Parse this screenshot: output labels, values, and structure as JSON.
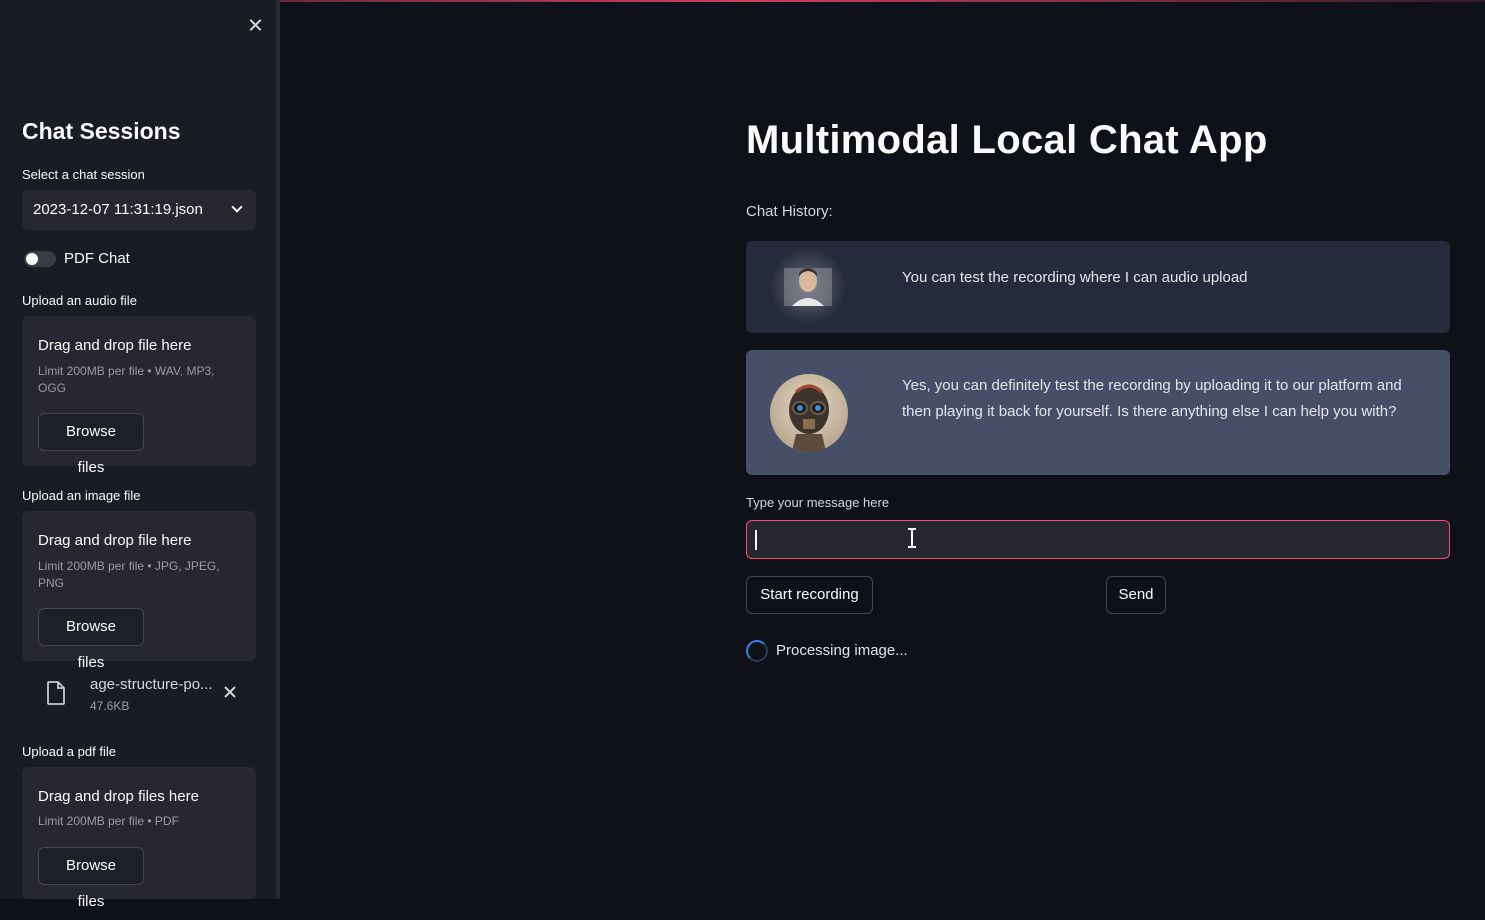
{
  "sidebar": {
    "title": "Chat Sessions",
    "session_label": "Select a chat session",
    "session_value": "2023-12-07 11:31:19.json",
    "pdf_toggle_label": "PDF Chat",
    "pdf_toggle_on": false,
    "audio": {
      "label": "Upload an audio file",
      "drop_text": "Drag and drop file here",
      "limit": "Limit 200MB per file • WAV, MP3, OGG",
      "button": "Browse files"
    },
    "image": {
      "label": "Upload an image file",
      "drop_text": "Drag and drop file here",
      "limit": "Limit 200MB per file • JPG, JPEG, PNG",
      "button": "Browse files",
      "uploaded_file": {
        "name": "age-structure-po...",
        "size": "47.6KB"
      }
    },
    "pdf": {
      "label": "Upload a pdf file",
      "drop_text": "Drag and drop files here",
      "limit": "Limit 200MB per file • PDF",
      "button": "Browse files"
    }
  },
  "main": {
    "title": "Multimodal Local Chat App",
    "history_label": "Chat History:",
    "messages": [
      {
        "role": "user",
        "text": "You can test the recording where I can audio upload"
      },
      {
        "role": "assistant",
        "text": "Yes, you can definitely test the recording by uploading it to our platform and then playing it back for yourself. Is there anything else I can help you with?"
      }
    ],
    "input_label": "Type your message here",
    "input_value": "",
    "record_button": "Start recording",
    "send_button": "Send",
    "status": "Processing image..."
  },
  "colors": {
    "background": "#0e1117",
    "sidebar": "#1a1c24",
    "accent": "#ff4b6b",
    "user_bubble": "#262b3b",
    "assistant_bubble": "#474e68"
  }
}
